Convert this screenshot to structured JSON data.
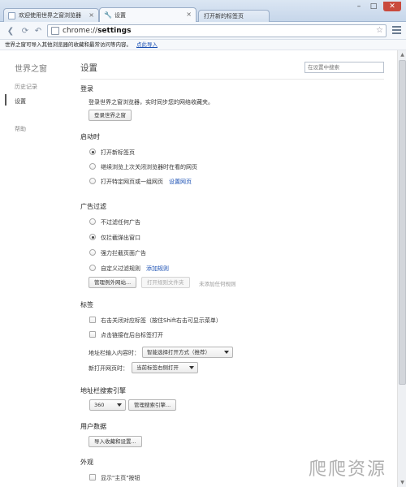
{
  "tabs": [
    {
      "label": "欢迎使用世界之窗浏览器",
      "active": false,
      "icon": "page-icon"
    },
    {
      "label": "设置",
      "active": true,
      "icon": "wrench-icon"
    },
    {
      "label": "打开新的标签页",
      "active": false,
      "icon": ""
    }
  ],
  "window_controls": {
    "minimize": "–",
    "maximize": "□",
    "close": "✕"
  },
  "toolbar": {
    "url_scheme": "chrome://",
    "url_host": "settings",
    "star_glyph": "☆"
  },
  "import_bar": {
    "text": "世界之窗可导入其他浏览器的收藏和最常访问等内容。",
    "link": "点此导入"
  },
  "sidebar": {
    "title": "世界之窗",
    "items": [
      {
        "label": "历史记录",
        "active": false
      },
      {
        "label": "设置",
        "active": true
      },
      {
        "label": "帮助",
        "active": false
      }
    ]
  },
  "main": {
    "title": "设置",
    "search_placeholder": "在设置中搜索",
    "login": {
      "title": "登录",
      "desc": "登录世界之窗浏览器，实时同步您的网络收藏夹。",
      "button": "登录世界之窗"
    },
    "startup": {
      "title": "启动时",
      "options": [
        {
          "label": "打开新标签页",
          "checked": true
        },
        {
          "label": "继续浏览上次关闭浏览器时在看的网页",
          "checked": false
        },
        {
          "label": "打开特定网页或一组网页",
          "checked": false
        }
      ],
      "set_pages_link": "设置网页"
    },
    "adblock": {
      "title": "广告过滤",
      "options": [
        {
          "label": "不过滤任何广告",
          "checked": false
        },
        {
          "label": "仅拦截弹出窗口",
          "checked": true
        },
        {
          "label": "强力拦截页面广告",
          "checked": false
        },
        {
          "label": "自定义过滤规则",
          "checked": false
        }
      ],
      "add_rule_link": "添加规则",
      "manage_button": "管理例外网站...",
      "open_rules_button": "打开规则文件夹",
      "no_rules_text": "未添加任何规则"
    },
    "tabs_section": {
      "title": "标签",
      "checks": [
        {
          "label": "右击关闭对应标签（按住Shift右击可显示菜单）",
          "checked": false
        },
        {
          "label": "点击链接在后台标签打开",
          "checked": false
        }
      ],
      "addressbar_label": "地址栏输入内容时：",
      "addressbar_value": "智能选择打开方式（推荐）",
      "newpage_label": "新打开网页时：",
      "newpage_value": "当前标签右侧打开"
    },
    "search_engine": {
      "title": "地址栏搜索引擎",
      "value": "360",
      "manage_button": "管理搜索引擎..."
    },
    "user_data": {
      "title": "用户数据",
      "import_button": "导入收藏和设置..."
    },
    "appearance": {
      "title": "外观",
      "show_home": "显示\"主页\"按钮"
    }
  },
  "watermark": "爬爬资源"
}
